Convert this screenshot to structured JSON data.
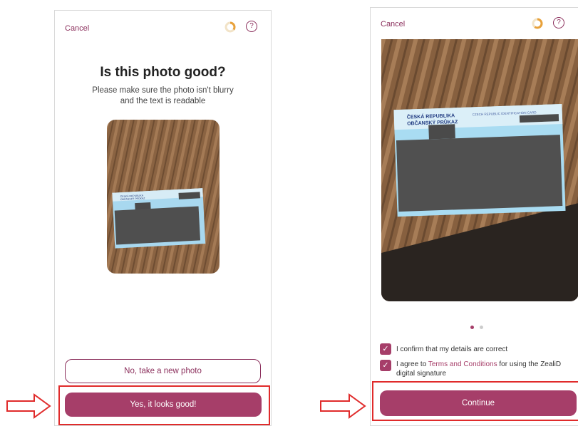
{
  "left_screen": {
    "cancel_label": "Cancel",
    "help_label": "?",
    "title": "Is this photo good?",
    "subtitle_line1": "Please make sure the photo isn't blurry",
    "subtitle_line2": "and the text is readable",
    "retake_button": "No, take a new photo",
    "confirm_button": "Yes, it looks good!",
    "progress_fraction": 0.35
  },
  "right_screen": {
    "cancel_label": "Cancel",
    "help_label": "?",
    "carousel": {
      "page": 1,
      "total": 2
    },
    "confirm_details_label": "I confirm that my details are correct",
    "terms_prefix": "I agree to",
    "terms_link": "Terms and Conditions",
    "terms_suffix": "for using the ZealiD digital signature",
    "continue_button": "Continue",
    "progress_fraction": 0.6
  },
  "id_card": {
    "header_left_1": "ČESKÁ REPUBLIKA",
    "header_left_2": "OBČANSKÝ PRŮKAZ",
    "header_right": "CZECH REPUBLIC  IDENTIFICATION CARD"
  },
  "colors": {
    "brand": "#a63e69",
    "highlight": "#e02b2b",
    "arrow": "#e02b2b"
  },
  "icons": {
    "progress": "progress-ring-icon",
    "help": "help-circle-icon",
    "check": "checkmark-icon",
    "arrow": "right-arrow-icon"
  }
}
